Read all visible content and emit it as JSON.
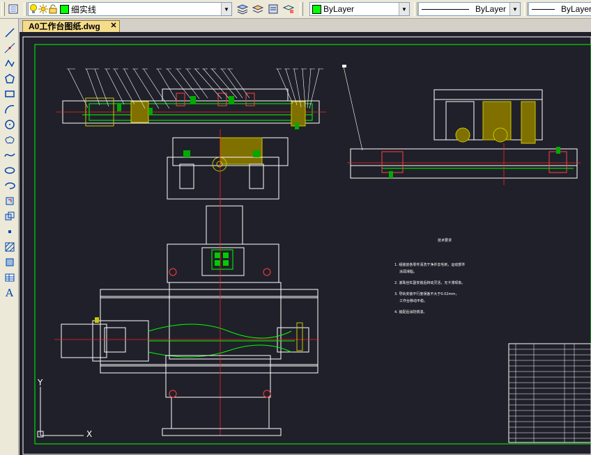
{
  "toolbar": {
    "layer_name": "细实线",
    "color_value": "ByLayer",
    "linetype_value": "ByLayer",
    "lineweight_value": "ByLayer",
    "layer_color": "#00ff00"
  },
  "document_tab": {
    "label": "A0工作台图纸.dwg",
    "close_glyph": "✕"
  },
  "left_toolbar": {
    "icons": [
      "line-icon",
      "construction-line-icon",
      "polyline-icon",
      "polygon-icon",
      "rectangle-icon",
      "arc-icon",
      "circle-icon",
      "revision-cloud-icon",
      "spline-icon",
      "ellipse-icon",
      "ellipse-arc-icon",
      "insert-block-icon",
      "make-block-icon",
      "point-icon",
      "hatch-icon",
      "region-icon",
      "table-icon",
      "multiline-text-icon"
    ],
    "text_tool_glyph": "A"
  },
  "drawing": {
    "ucs_y_label": "Y",
    "ucs_x_label": "X",
    "tech_notes": [
      "技术要求",
      "1. 组装前各零件清洗干净并去毛刺，运动部件",
      "   涂润滑脂。",
      "2. 滚珠丝杠副安装后转动灵活，无卡滞现象。",
      "3. 导轨安装平行度误差不大于0.02mm，",
      "   工作台移动平稳。",
      "4. 装配后涂防锈漆。"
    ]
  }
}
